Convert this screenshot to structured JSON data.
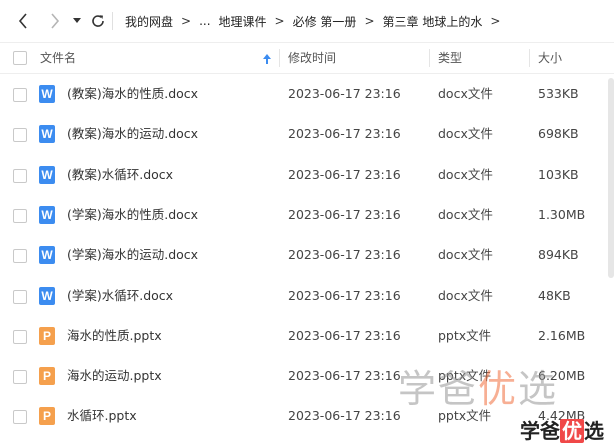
{
  "breadcrumb": {
    "items": [
      "我的网盘",
      "...",
      "地理课件",
      "必修 第一册",
      "第三章 地球上的水"
    ],
    "separator": ">"
  },
  "columns": {
    "name": "文件名",
    "modified": "修改时间",
    "type": "类型",
    "size": "大小"
  },
  "files": [
    {
      "name": "(教案)海水的性质.docx",
      "modified": "2023-06-17 23:16",
      "type": "docx文件",
      "size": "533KB",
      "icon": "W",
      "kind": "docx"
    },
    {
      "name": "(教案)海水的运动.docx",
      "modified": "2023-06-17 23:16",
      "type": "docx文件",
      "size": "698KB",
      "icon": "W",
      "kind": "docx"
    },
    {
      "name": "(教案)水循环.docx",
      "modified": "2023-06-17 23:16",
      "type": "docx文件",
      "size": "103KB",
      "icon": "W",
      "kind": "docx"
    },
    {
      "name": "(学案)海水的性质.docx",
      "modified": "2023-06-17 23:16",
      "type": "docx文件",
      "size": "1.30MB",
      "icon": "W",
      "kind": "docx"
    },
    {
      "name": "(学案)海水的运动.docx",
      "modified": "2023-06-17 23:16",
      "type": "docx文件",
      "size": "894KB",
      "icon": "W",
      "kind": "docx"
    },
    {
      "name": "(学案)水循环.docx",
      "modified": "2023-06-17 23:16",
      "type": "docx文件",
      "size": "48KB",
      "icon": "W",
      "kind": "docx"
    },
    {
      "name": "海水的性质.pptx",
      "modified": "2023-06-17 23:16",
      "type": "pptx文件",
      "size": "2.16MB",
      "icon": "P",
      "kind": "pptx"
    },
    {
      "name": "海水的运动.pptx",
      "modified": "2023-06-17 23:16",
      "type": "pptx文件",
      "size": "6.20MB",
      "icon": "P",
      "kind": "pptx"
    },
    {
      "name": "水循环.pptx",
      "modified": "2023-06-17 23:16",
      "type": "pptx文件",
      "size": "4.42MB",
      "icon": "P",
      "kind": "pptx"
    }
  ],
  "watermark": {
    "text_a": "学爸",
    "text_b": "优",
    "text_c": "选"
  },
  "colors": {
    "docx": "#3c8cf0",
    "pptx": "#f5a04d",
    "sort_arrow": "#3c8cf0"
  },
  "icons": {
    "back": "chevron-left-icon",
    "forward": "chevron-right-icon",
    "history": "caret-down-icon",
    "refresh": "refresh-icon",
    "sort": "sort-up-arrow-icon"
  }
}
